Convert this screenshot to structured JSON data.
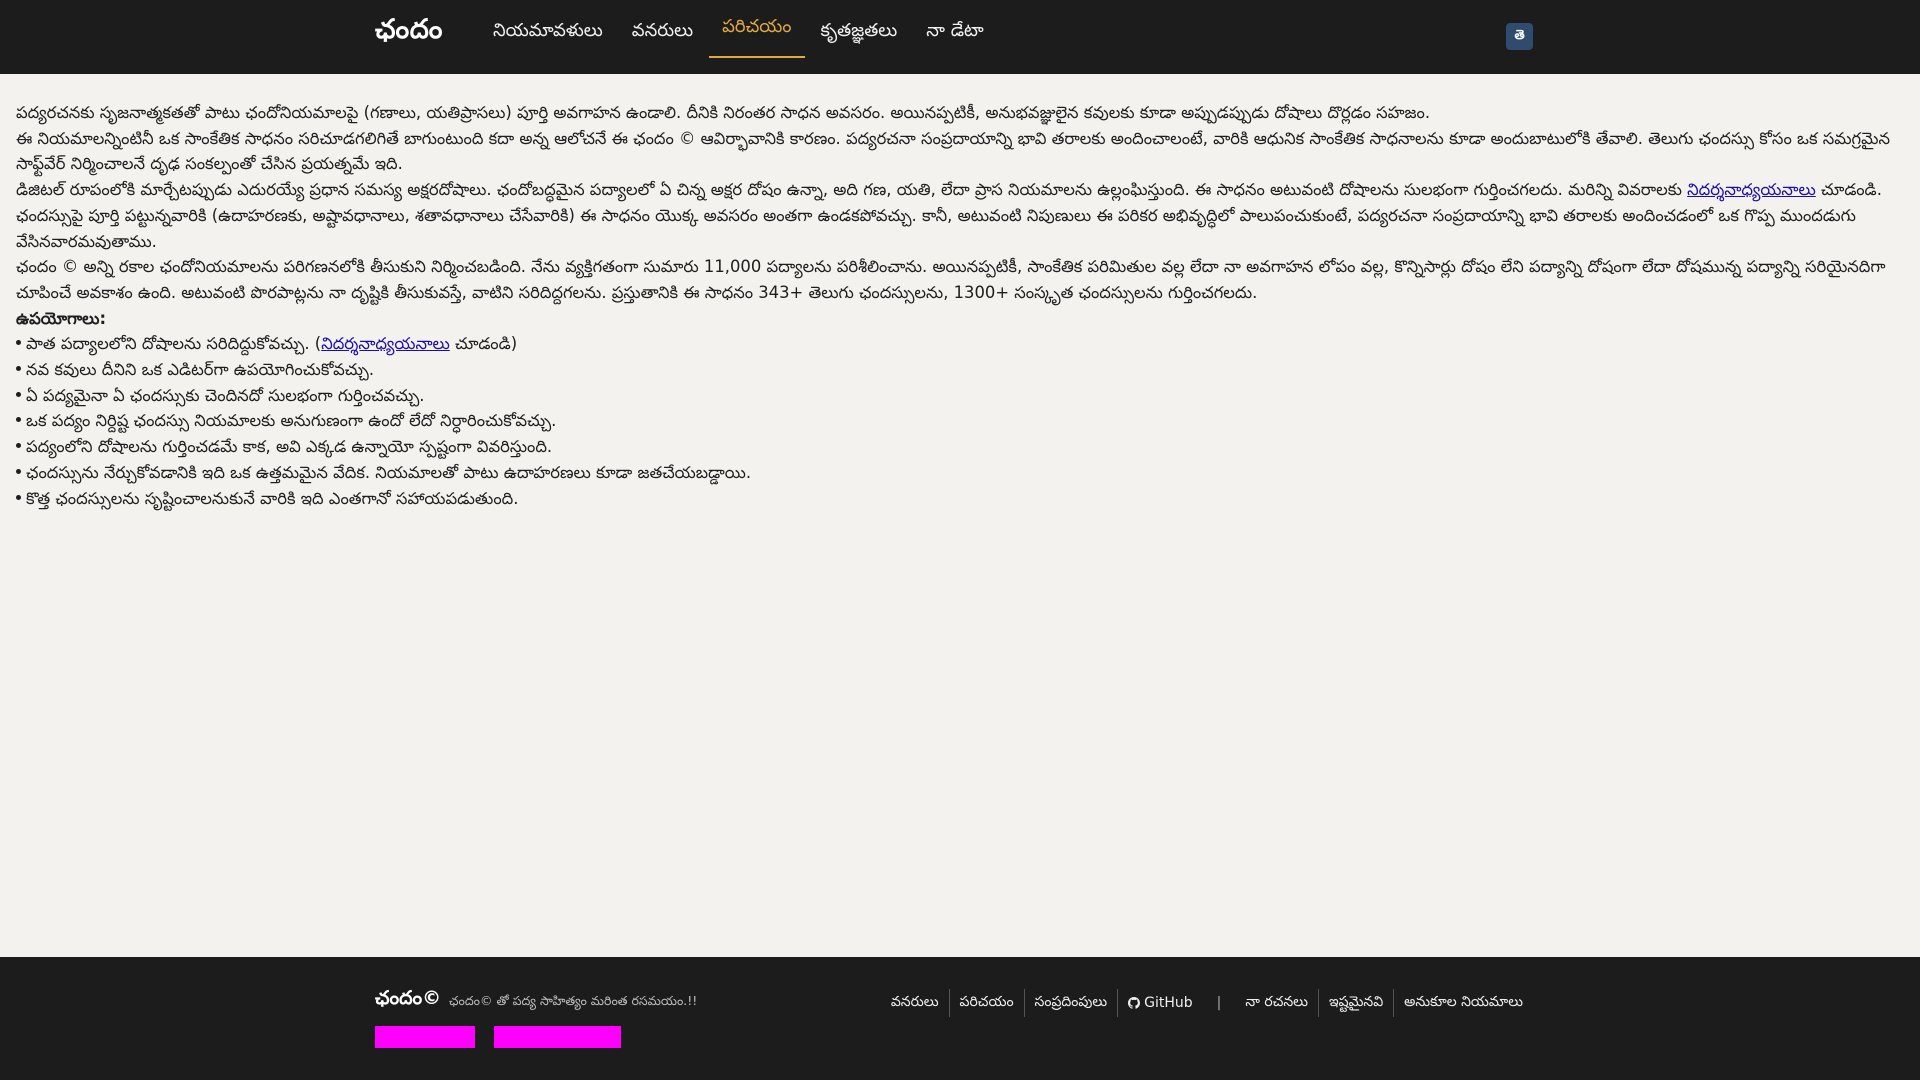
{
  "header": {
    "brand": "ఛందం",
    "nav": [
      {
        "label": "నియమావళులు",
        "active": false
      },
      {
        "label": "వనరులు",
        "active": false
      },
      {
        "label": "పరిచయం",
        "active": true
      },
      {
        "label": "కృతజ్ఞతలు",
        "active": false
      },
      {
        "label": "నా డేటా",
        "active": false
      }
    ],
    "lang_button": "తె"
  },
  "content": {
    "para1": "పద్యరచనకు సృజనాత్మకతతో పాటు ఛందోనియమాలపై (గణాలు, యతిప్రాసలు) పూర్తి అవగాహన ఉండాలి. దీనికి నిరంతర సాధన అవసరం. అయినప్పటికీ, అనుభవజ్ఞులైన కవులకు కూడా అప్పుడప్పుడు దోషాలు దొర్లడం సహజం.",
    "para2": "ఈ నియమాలన్నింటినీ ఒక సాంకేతిక సాధనం సరిచూడగలిగితే బాగుంటుంది కదా అన్న ఆలోచనే ఈ ఛందం © ఆవిర్భావానికి కారణం. పద్యరచనా సంప్రదాయాన్ని భావి తరాలకు అందించాలంటే, వారికి ఆధునిక సాంకేతిక సాధనాలను కూడా అందుబాటులోకి తేవాలి. తెలుగు ఛందస్సు కోసం ఒక సమగ్రమైన సాఫ్ట్‌వేర్ నిర్మించాలనే దృఢ సంకల్పంతో చేసిన ప్రయత్నమే ఇది.",
    "para3_before": "డిజిటల్ రూపంలోకి మార్చేటప్పుడు ఎదురయ్యే ప్రధాన సమస్య అక్షరదోషాలు. ఛందోబద్ధమైన పద్యాలలో ఏ చిన్న అక్షర దోషం ఉన్నా, అది గణ, యతి, లేదా ప్రాస నియమాలను ఉల్లంఘిస్తుంది. ఈ సాధనం అటువంటి దోషాలను సులభంగా గుర్తించగలదు. మరిన్ని వివరాలకు ",
    "para3_link": "నిదర్శనాధ్యయనాలు",
    "para3_after": " చూడండి.",
    "para4": "ఛందస్సుపై పూర్తి పట్టున్నవారికి (ఉదాహరణకు, అష్టావధానాలు, శతావధానాలు చేసేవారికి) ఈ సాధనం యొక్క అవసరం అంతగా ఉండకపోవచ్చు. కానీ, అటువంటి నిపుణులు ఈ పరికర అభివృద్ధిలో పాలుపంచుకుంటే, పద్యరచనా సంప్రదాయాన్ని భావి తరాలకు అందించడంలో ఒక గొప్ప ముందడుగు వేసినవారమవుతాము.",
    "para5": "ఛందం © అన్ని రకాల ఛందోనియమాలను పరిగణనలోకి తీసుకుని నిర్మించబడింది. నేను వ్యక్తిగతంగా సుమారు 11,000 పద్యాలను పరిశీలించాను. అయినప్పటికీ, సాంకేతిక పరిమితుల వల్ల లేదా నా అవగాహన లోపం వల్ల, కొన్నిసార్లు దోషం లేని పద్యాన్ని దోషంగా లేదా దోషమున్న పద్యాన్ని సరియైనదిగా చూపించే అవకాశం ఉంది. అటువంటి పొరపాట్లను నా దృష్టికి తీసుకువస్తే, వాటిని సరిదిద్దగలను. ప్రస్తుతానికి ఈ సాధనం 343+ తెలుగు ఛందస్సులను, 1300+ సంస్కృత ఛందస్సులను గుర్తించగలదు.",
    "uses_title": "ఉపయోగాలు:",
    "use1_before": "పాత పద్యాలలోని దోషాలను సరిదిద్దుకోవచ్చు. (",
    "use1_link": "నిదర్శనాధ్యయనాలు",
    "use1_after": " చూడండి)",
    "use2": "నవ కవులు దీనిని ఒక ఎడిటర్‌గా ఉపయోగించుకోవచ్చు.",
    "use3": "ఏ పద్యమైనా ఏ ఛందస్సుకు చెందినదో సులభంగా గుర్తించవచ్చు.",
    "use4": "ఒక పద్యం నిర్దిష్ట ఛందస్సు నియమాలకు అనుగుణంగా ఉందో లేదో నిర్ధారించుకోవచ్చు.",
    "use5": "పద్యంలోని దోషాలను గుర్తించడమే కాక, అవి ఎక్కడ ఉన్నాయో స్పష్టంగా వివరిస్తుంది.",
    "use6": "ఛందస్సును నేర్చుకోవడానికి ఇది ఒక ఉత్తమమైన వేదిక. నియమాలతో పాటు ఉదాహరణలు కూడా జతచేయబడ్డాయి.",
    "use7": "కొత్త ఛందస్సులను సృష్టించాలనుకునే వారికి ఇది ఎంతగానో సహాయపడుతుంది."
  },
  "footer": {
    "brand": "ఛందం©",
    "tagline": "ఛందం© తో పద్య సాహిత్యం మరింత రసమయం.!!",
    "links": {
      "resources": "వనరులు",
      "intro": "పరిచయం",
      "contact": "సంప్రదింపులు",
      "github": "GitHub",
      "pipe": "|",
      "my_works": "నా రచనలు",
      "favorites": "ఇష్టమైనవి",
      "custom_rules": "అనుకూల నియమాలు"
    },
    "badge_color": "#ff00ff"
  }
}
